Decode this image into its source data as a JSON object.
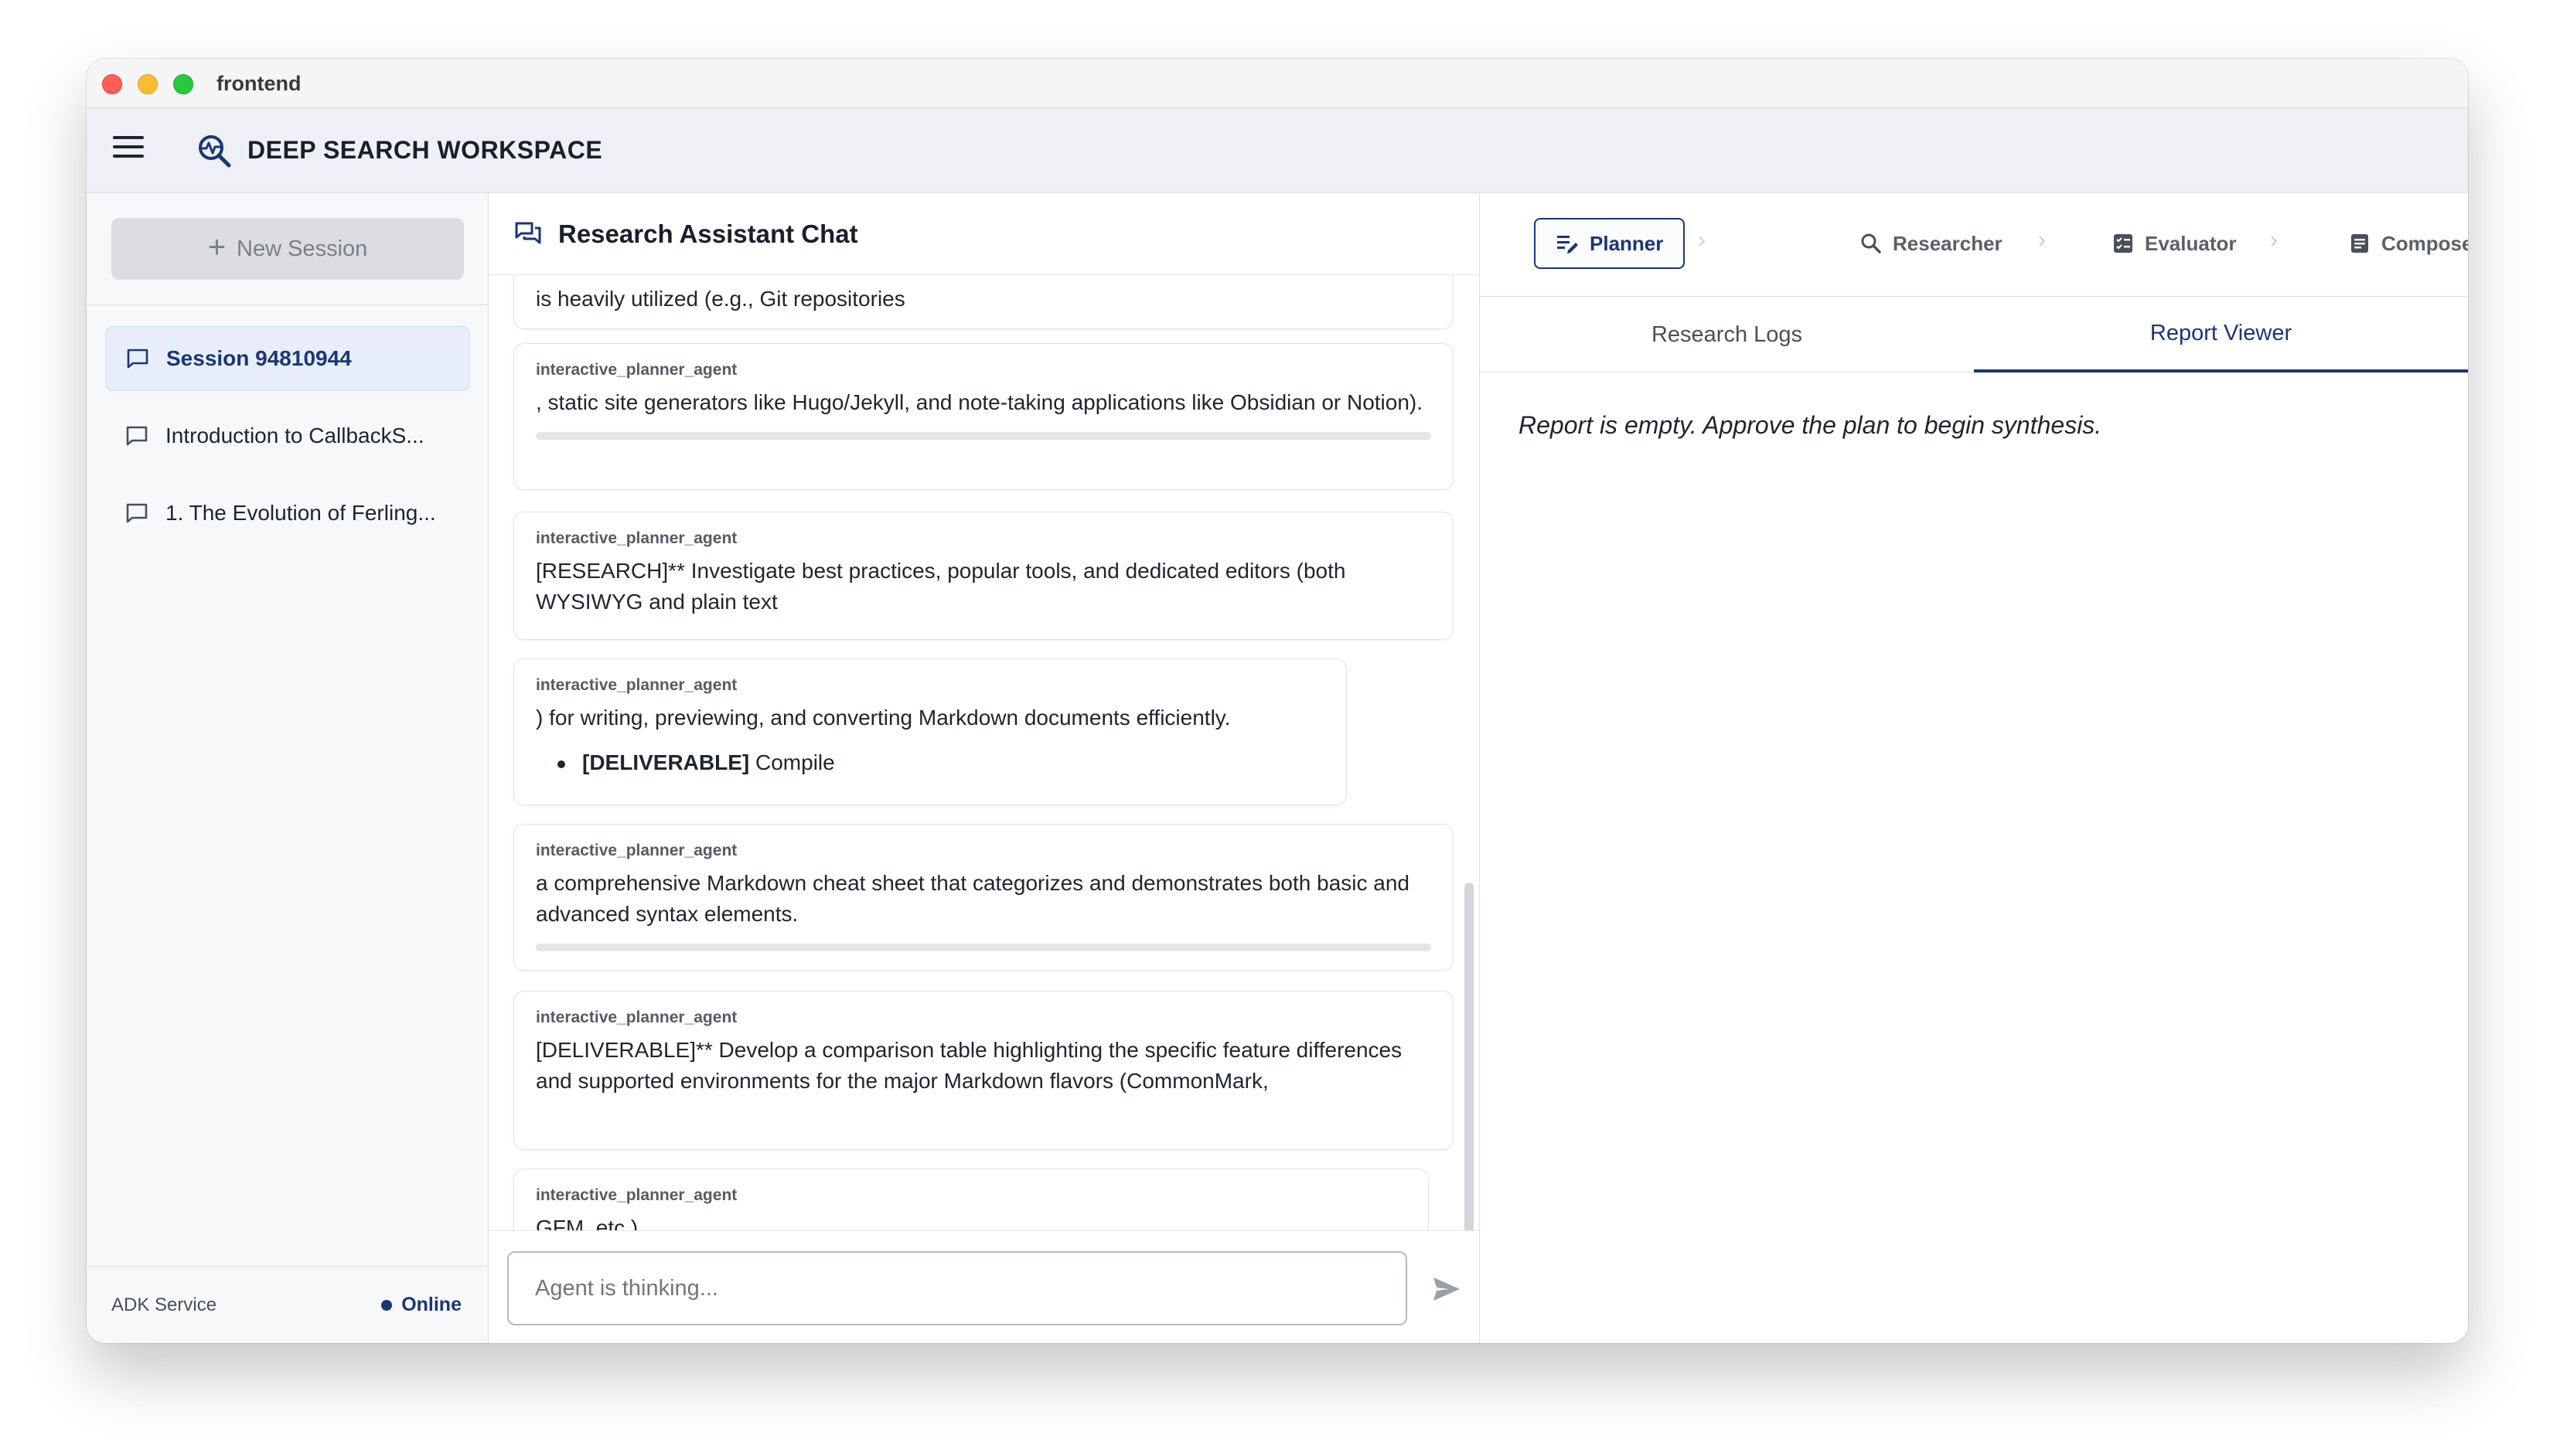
{
  "window": {
    "title": "frontend"
  },
  "app": {
    "title": "DEEP SEARCH WORKSPACE"
  },
  "sidebar": {
    "new_session_label": "New Session",
    "sessions": [
      {
        "label": "Session 94810944",
        "active": true
      },
      {
        "label": "Introduction to CallbackS...",
        "active": false
      },
      {
        "label": "1. The Evolution of Ferling...",
        "active": false
      }
    ],
    "footer": {
      "service_label": "ADK Service",
      "status": "Online"
    }
  },
  "chat": {
    "title": "Research Assistant Chat",
    "messages": [
      {
        "author": "",
        "text": "is heavily utilized (e.g., Git repositories"
      },
      {
        "author": "interactive_planner_agent",
        "text": ", static site generators like Hugo/Jekyll, and note-taking applications like Obsidian or Notion)."
      },
      {
        "author": "interactive_planner_agent",
        "text": "[RESEARCH]** Investigate best practices, popular tools, and dedicated editors (both WYSIWYG and plain text"
      },
      {
        "author": "interactive_planner_agent",
        "text": ") for writing, previewing, and converting Markdown documents efficiently.",
        "bullet_bold": "[DELIVERABLE]",
        "bullet_text": " Compile"
      },
      {
        "author": "interactive_planner_agent",
        "text": "a comprehensive Markdown cheat sheet that categorizes and demonstrates both basic and advanced syntax elements."
      },
      {
        "author": "interactive_planner_agent",
        "text": "[DELIVERABLE]** Develop a comparison table highlighting the specific feature differences and supported environments for the major Markdown flavors (CommonMark,"
      },
      {
        "author": "interactive_planner_agent",
        "text": "GFM, etc.)"
      }
    ],
    "input_placeholder": "Agent is thinking..."
  },
  "workflow": {
    "steps": [
      {
        "label": "Planner",
        "icon": "planner-icon",
        "active": true
      },
      {
        "label": "Researcher",
        "icon": "search-icon",
        "active": false
      },
      {
        "label": "Evaluator",
        "icon": "evaluator-icon",
        "active": false
      },
      {
        "label": "Composer",
        "icon": "composer-icon",
        "active": false
      }
    ]
  },
  "tabs": [
    {
      "label": "Research Logs",
      "active": false
    },
    {
      "label": "Report Viewer",
      "active": true
    }
  ],
  "report": {
    "empty_message": "Report is empty. Approve the plan to begin synthesis."
  },
  "colors": {
    "accent": "#1a3579",
    "online": "#1a3579",
    "active_session_bg": "#e7eef9"
  }
}
